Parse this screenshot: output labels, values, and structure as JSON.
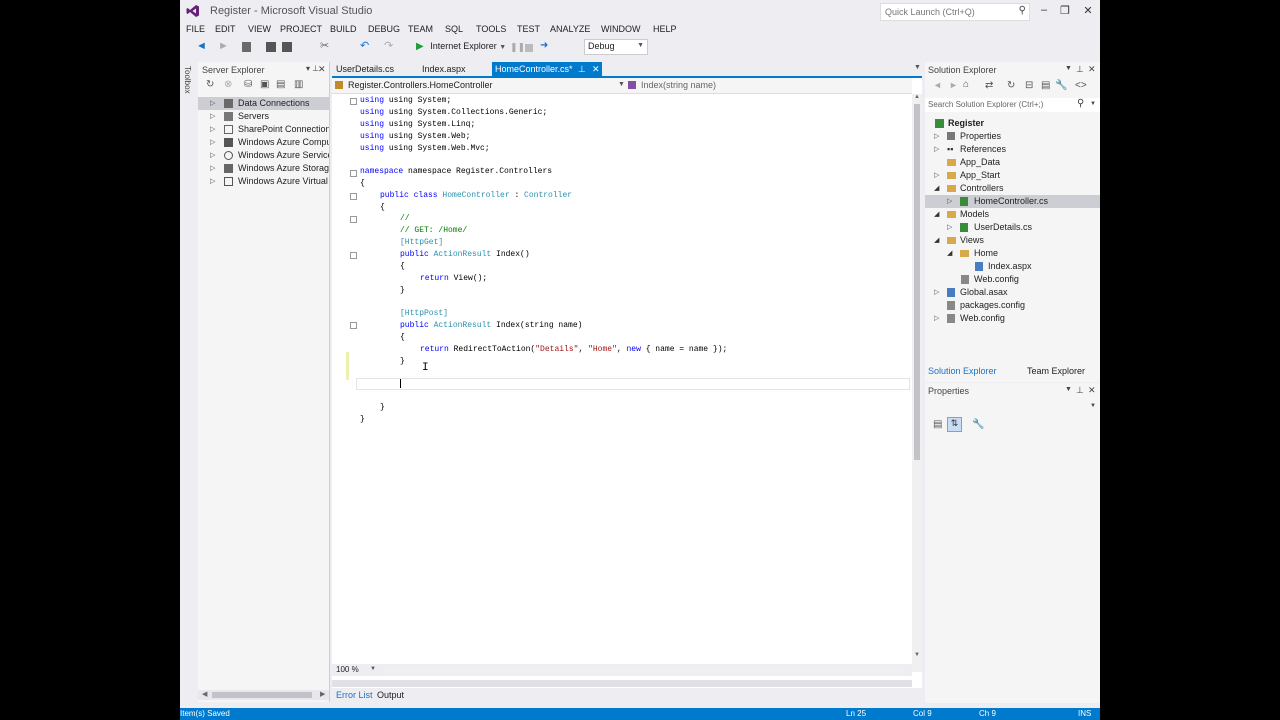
{
  "app_title": "Register - Microsoft Visual Studio",
  "quick_launch_placeholder": "Quick Launch (Ctrl+Q)",
  "menu": [
    "FILE",
    "EDIT",
    "VIEW",
    "PROJECT",
    "BUILD",
    "DEBUG",
    "TEAM",
    "SQL",
    "TOOLS",
    "TEST",
    "ANALYZE",
    "WINDOW",
    "HELP"
  ],
  "toolbar": {
    "run_target": "Internet Explorer",
    "config": "Debug"
  },
  "toolbox_label": "Toolbox",
  "server_explorer": {
    "title": "Server Explorer",
    "items": [
      "Data Connections",
      "Servers",
      "SharePoint Connections",
      "Windows Azure Compute",
      "Windows Azure Service Bus",
      "Windows Azure Storage",
      "Windows Azure Virtual Machines"
    ]
  },
  "tabs": [
    "UserDetails.cs",
    "Index.aspx",
    "HomeController.cs*"
  ],
  "nav": {
    "left": "Register.Controllers.HomeController",
    "right": "Index(string name)"
  },
  "code": {
    "l1": "using System;",
    "l2": "using System.Collections.Generic;",
    "l3": "using System.Linq;",
    "l4": "using System.Web;",
    "l5": "using System.Web.Mvc;",
    "ns": "namespace Register.Controllers",
    "brace_open": "{",
    "brace_close": "}",
    "cls_pre": "public class ",
    "cls_name": "HomeController",
    "cls_sep": " : ",
    "cls_base": "Controller",
    "c1": "//",
    "c2": "// GET: /Home/",
    "attr_get": "[HttpGet]",
    "attr_post": "[HttpPost]",
    "pub": "public ",
    "ar": "ActionResult",
    "m1_sig": " Index()",
    "m2_sig": " Index(string name)",
    "ret1_kw": "return ",
    "ret1": "View();",
    "ret2_a": "RedirectToAction(",
    "ret2_s1": "\"Details\"",
    "ret2_comma": ", ",
    "ret2_s2": "\"Home\"",
    "ret2_new": "new",
    "ret2_tail": " { name = name });"
  },
  "zoom": "100 %",
  "bottom_tabs": [
    "Error List",
    "Output"
  ],
  "solution_explorer": {
    "title": "Solution Explorer",
    "search_placeholder": "Search Solution Explorer (Ctrl+;)",
    "items": [
      "Register",
      "Properties",
      "References",
      "App_Data",
      "App_Start",
      "Controllers",
      "HomeController.cs",
      "Models",
      "UserDetails.cs",
      "Views",
      "Home",
      "Index.aspx",
      "Web.config",
      "Global.asax",
      "packages.config",
      "Web.config"
    ],
    "bottom_tabs": [
      "Solution Explorer",
      "Team Explorer"
    ]
  },
  "properties": {
    "title": "Properties"
  },
  "status": {
    "left": "Item(s) Saved",
    "ln": "Ln 25",
    "col": "Col 9",
    "ch": "Ch 9",
    "mode": "INS"
  },
  "colors": {
    "accent": "#007acc",
    "keyword": "#0000ff",
    "type": "#2b91af",
    "comment": "#008000",
    "string": "#a31515"
  }
}
